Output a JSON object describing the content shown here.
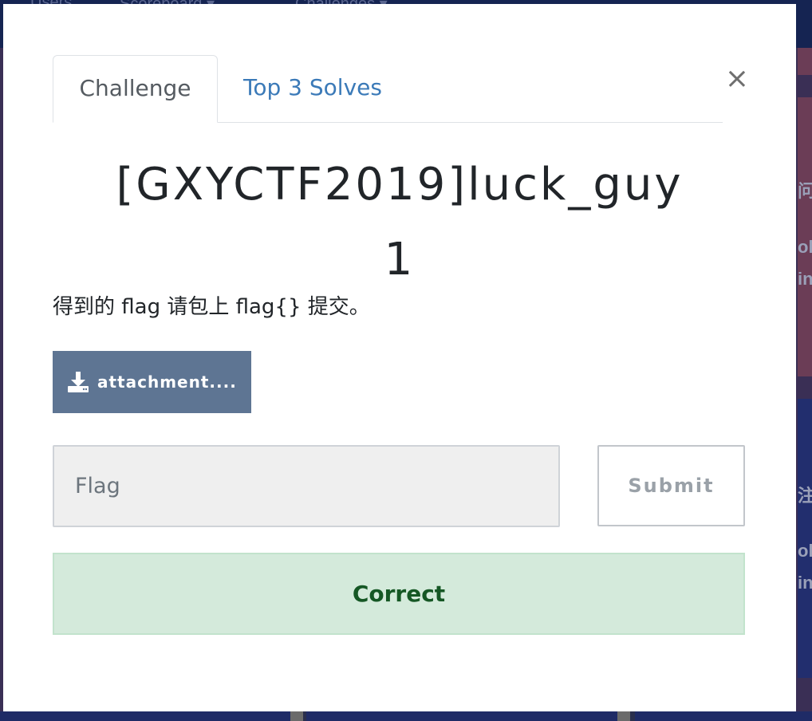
{
  "background": {
    "nav_items": [
      "Users",
      "Scoreboard ▾",
      "Challenges ▾"
    ],
    "card_fragments_red": [
      "问",
      "ol",
      "in"
    ],
    "card_fragments_blue": [
      "注册",
      "ol",
      "in"
    ]
  },
  "modal": {
    "close_label": "×",
    "tabs": [
      {
        "label": "Challenge",
        "active": true
      },
      {
        "label": "Top 3 Solves",
        "active": false
      }
    ],
    "title": "[GXYCTF2019]luck_guy",
    "value": "1",
    "description": "得到的 flag 请包上 flag{} 提交。",
    "attachment_label": "attachment....",
    "flag_input": {
      "value": "",
      "placeholder": "Flag"
    },
    "submit_label": "Submit",
    "result_message": "Correct"
  },
  "colors": {
    "attachment_button": "#5e7593",
    "tab_link": "#3b7ab8",
    "success_background": "#d4eadb",
    "success_text": "#155724"
  },
  "icons": {
    "attachment": "download-icon",
    "close": "close-icon"
  }
}
